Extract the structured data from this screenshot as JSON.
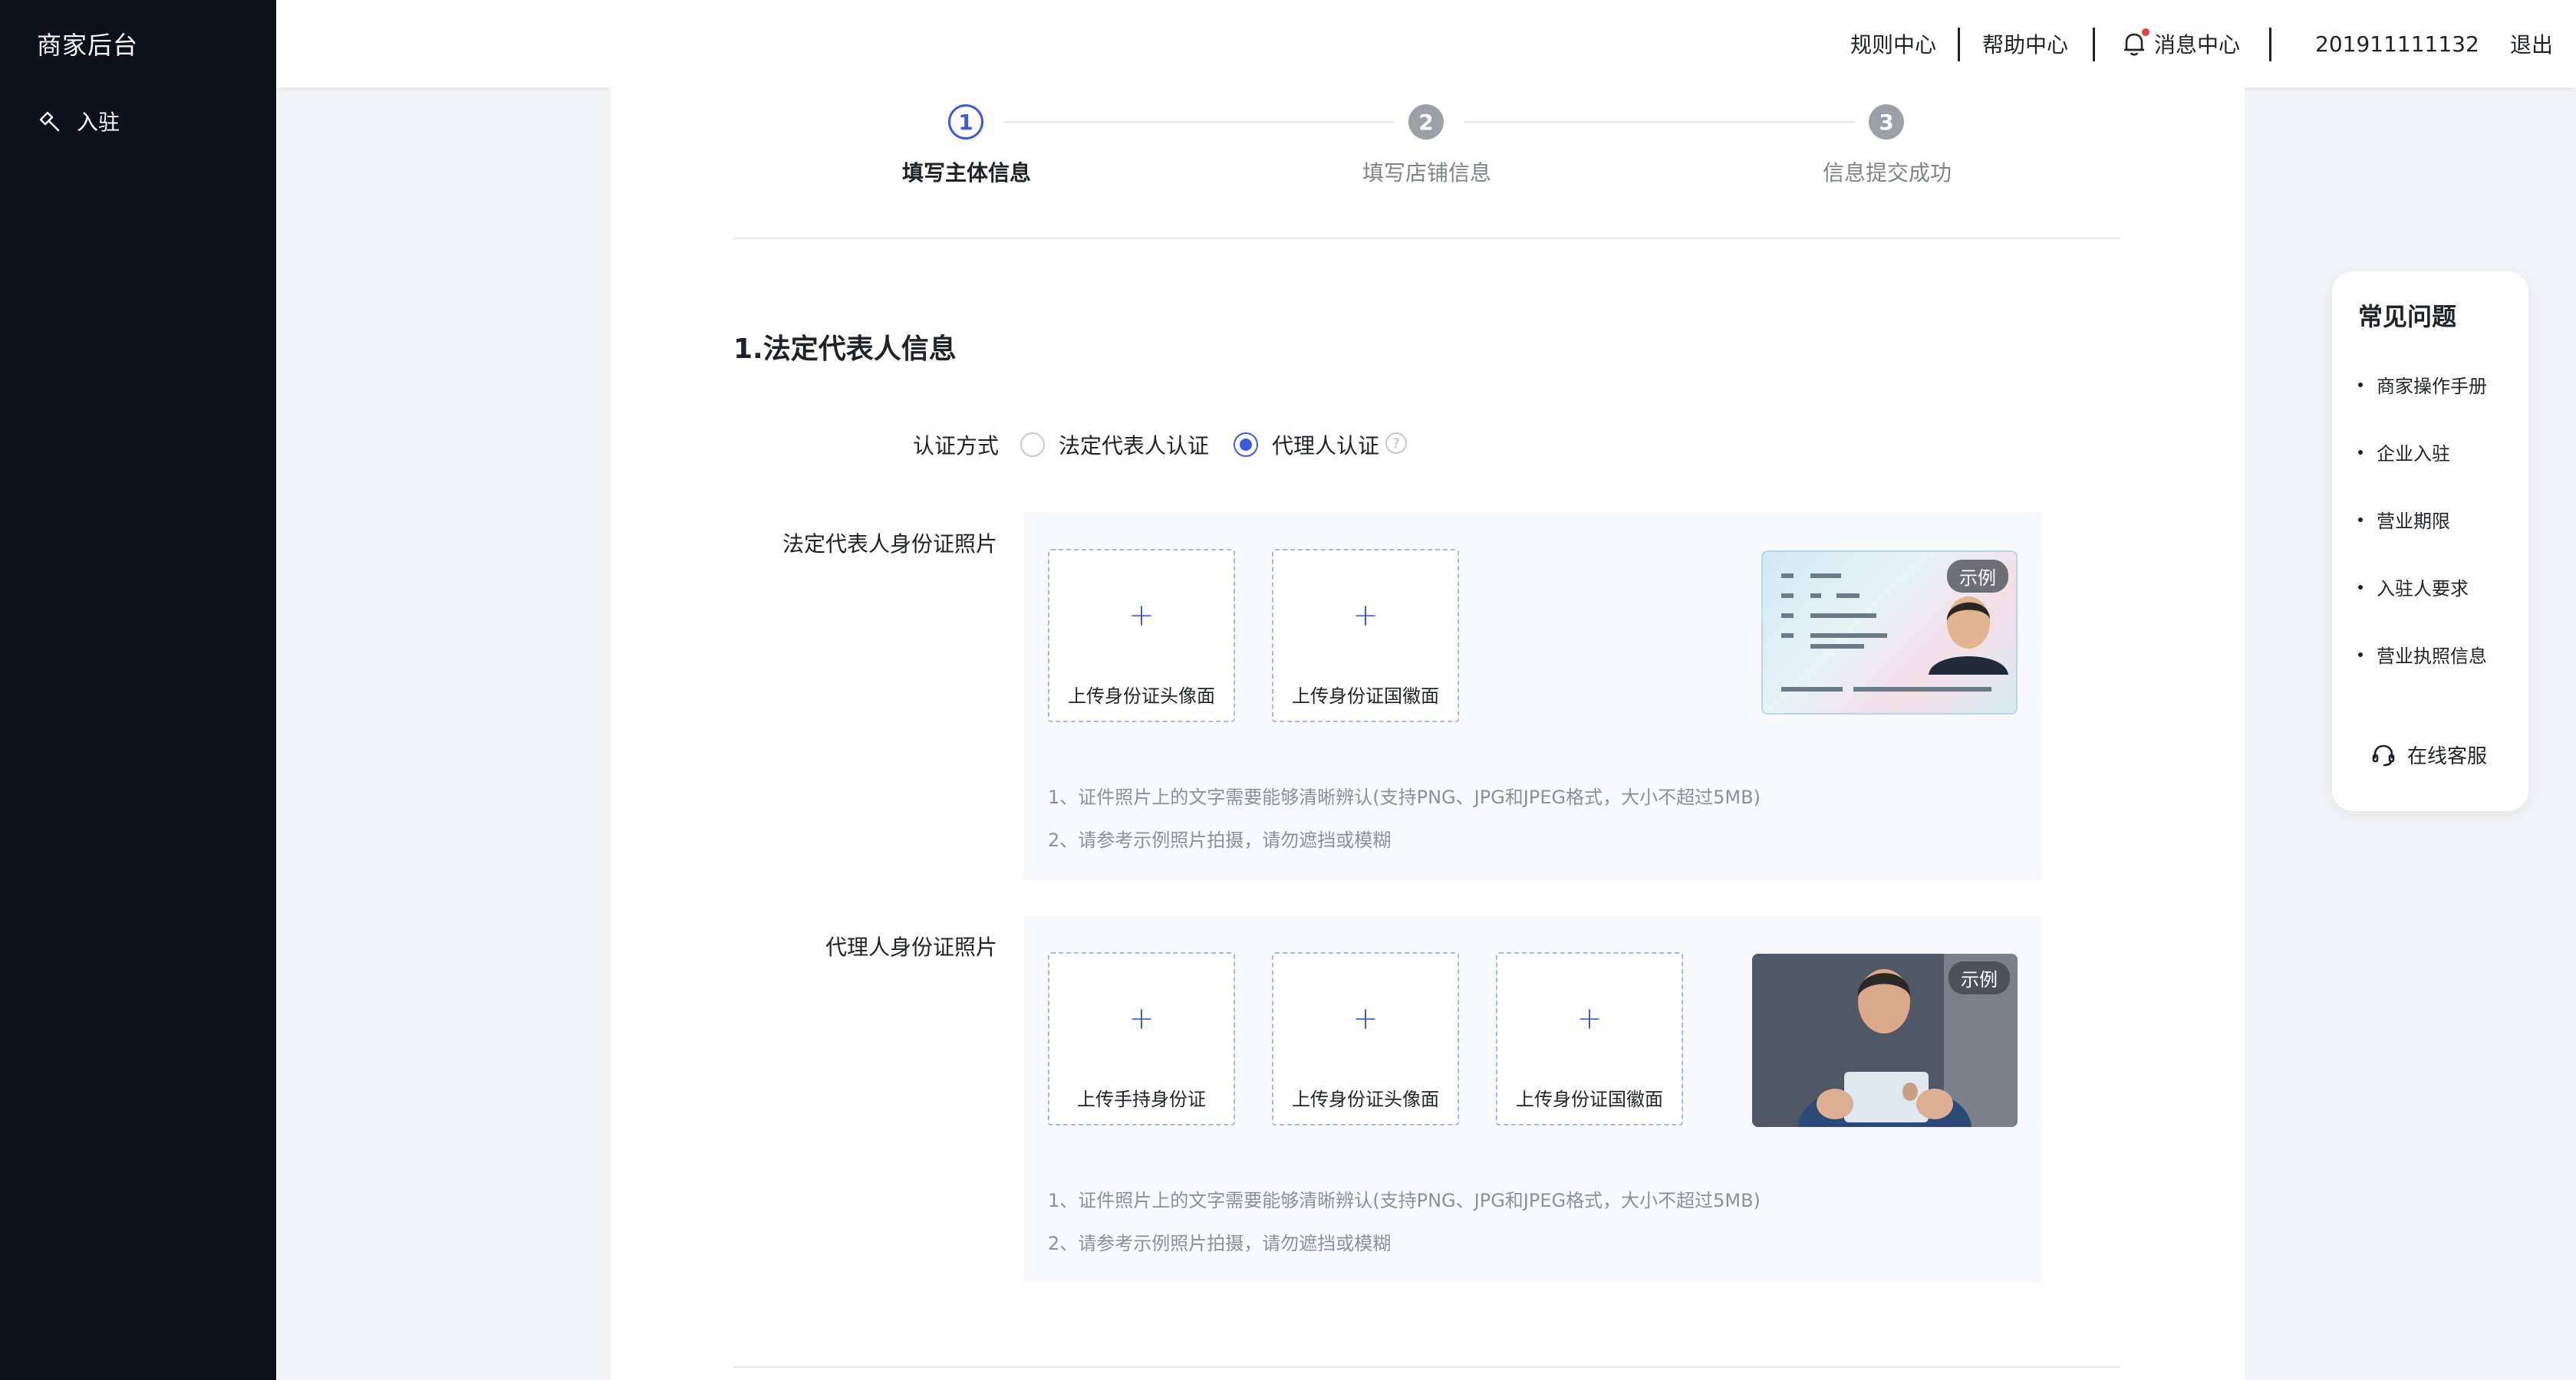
{
  "sidebar": {
    "brand": "商家后台",
    "items": [
      {
        "label": "入驻",
        "icon": "hammer-icon"
      }
    ]
  },
  "header": {
    "rules": "规则中心",
    "help": "帮助中心",
    "messages": "消息中心",
    "account": "201911111132",
    "logout": "退出"
  },
  "steps": [
    {
      "num": "1",
      "label": "填写主体信息",
      "state": "active"
    },
    {
      "num": "2",
      "label": "填写店铺信息",
      "state": "todo"
    },
    {
      "num": "3",
      "label": "信息提交成功",
      "state": "todo"
    }
  ],
  "section": {
    "title": "1.法定代表人信息"
  },
  "auth": {
    "label": "认证方式",
    "options": [
      {
        "label": "法定代表人认证",
        "selected": false
      },
      {
        "label": "代理人认证",
        "selected": true
      }
    ],
    "help_glyph": "?"
  },
  "legal_id": {
    "label": "法定代表人身份证照片",
    "uploads": [
      "上传身份证头像面",
      "上传身份证国徽面"
    ],
    "sample_badge": "示例",
    "notes": [
      "1、证件照片上的文字需要能够清晰辨认(支持PNG、JPG和JPEG格式，大小不超过5MB)",
      "2、请参考示例照片拍摄，请勿遮挡或模糊"
    ]
  },
  "agent_id": {
    "label": "代理人身份证照片",
    "uploads": [
      "上传手持身份证",
      "上传身份证头像面",
      "上传身份证国徽面"
    ],
    "sample_badge": "示例",
    "notes": [
      "1、证件照片上的文字需要能够清晰辨认(支持PNG、JPG和JPEG格式，大小不超过5MB)",
      "2、请参考示例照片拍摄，请勿遮挡或模糊"
    ]
  },
  "plus_glyph": "+",
  "faq": {
    "title": "常见问题",
    "items": [
      "商家操作手册",
      "企业入驻",
      "营业期限",
      "入驻人要求",
      "营业执照信息"
    ],
    "service": "在线客服"
  },
  "colors": {
    "accent": "#3b5bdb",
    "sidebar_bg": "#0c111b",
    "notify_dot": "#e64141"
  }
}
